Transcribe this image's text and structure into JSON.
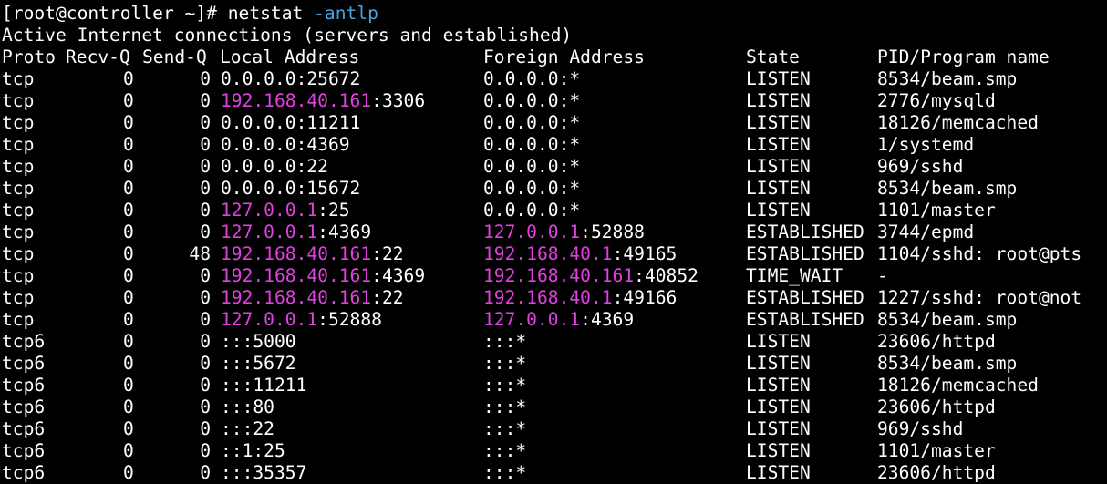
{
  "colors": {
    "background": "#000000",
    "text": "#ffffff",
    "ip_highlight": "#e040e0",
    "flag_highlight": "#4aa3e0"
  },
  "prompt": {
    "text": "[root@controller ~]# ",
    "command": "netstat",
    "flags": "-antlp"
  },
  "summary": "Active Internet connections (servers and established)",
  "headers": {
    "proto": "Proto",
    "recvq": "Recv-Q",
    "sendq": "Send-Q",
    "local": "Local Address",
    "foreign": "Foreign Address",
    "state": "State",
    "pid": "PID/Program name"
  },
  "rows": [
    {
      "proto": "tcp",
      "recvq": "0",
      "sendq": "0",
      "local_ip": "",
      "local_rest": "0.0.0.0:25672",
      "foreign_ip": "",
      "foreign_rest": "0.0.0.0:*",
      "state": "LISTEN",
      "pid": "8534/beam.smp"
    },
    {
      "proto": "tcp",
      "recvq": "0",
      "sendq": "0",
      "local_ip": "192.168.40.161",
      "local_rest": ":3306",
      "foreign_ip": "",
      "foreign_rest": "0.0.0.0:*",
      "state": "LISTEN",
      "pid": "2776/mysqld"
    },
    {
      "proto": "tcp",
      "recvq": "0",
      "sendq": "0",
      "local_ip": "",
      "local_rest": "0.0.0.0:11211",
      "foreign_ip": "",
      "foreign_rest": "0.0.0.0:*",
      "state": "LISTEN",
      "pid": "18126/memcached"
    },
    {
      "proto": "tcp",
      "recvq": "0",
      "sendq": "0",
      "local_ip": "",
      "local_rest": "0.0.0.0:4369",
      "foreign_ip": "",
      "foreign_rest": "0.0.0.0:*",
      "state": "LISTEN",
      "pid": "1/systemd"
    },
    {
      "proto": "tcp",
      "recvq": "0",
      "sendq": "0",
      "local_ip": "",
      "local_rest": "0.0.0.0:22",
      "foreign_ip": "",
      "foreign_rest": "0.0.0.0:*",
      "state": "LISTEN",
      "pid": "969/sshd"
    },
    {
      "proto": "tcp",
      "recvq": "0",
      "sendq": "0",
      "local_ip": "",
      "local_rest": "0.0.0.0:15672",
      "foreign_ip": "",
      "foreign_rest": "0.0.0.0:*",
      "state": "LISTEN",
      "pid": "8534/beam.smp"
    },
    {
      "proto": "tcp",
      "recvq": "0",
      "sendq": "0",
      "local_ip": "127.0.0.1",
      "local_rest": ":25",
      "foreign_ip": "",
      "foreign_rest": "0.0.0.0:*",
      "state": "LISTEN",
      "pid": "1101/master"
    },
    {
      "proto": "tcp",
      "recvq": "0",
      "sendq": "0",
      "local_ip": "127.0.0.1",
      "local_rest": ":4369",
      "foreign_ip": "127.0.0.1",
      "foreign_rest": ":52888",
      "state": "ESTABLISHED",
      "pid": "3744/epmd"
    },
    {
      "proto": "tcp",
      "recvq": "0",
      "sendq": "48",
      "local_ip": "192.168.40.161",
      "local_rest": ":22",
      "foreign_ip": "192.168.40.1",
      "foreign_rest": ":49165",
      "state": "ESTABLISHED",
      "pid": "1104/sshd: root@pts"
    },
    {
      "proto": "tcp",
      "recvq": "0",
      "sendq": "0",
      "local_ip": "192.168.40.161",
      "local_rest": ":4369",
      "foreign_ip": "192.168.40.161",
      "foreign_rest": ":40852",
      "state": "TIME_WAIT",
      "pid": "-"
    },
    {
      "proto": "tcp",
      "recvq": "0",
      "sendq": "0",
      "local_ip": "192.168.40.161",
      "local_rest": ":22",
      "foreign_ip": "192.168.40.1",
      "foreign_rest": ":49166",
      "state": "ESTABLISHED",
      "pid": "1227/sshd: root@not"
    },
    {
      "proto": "tcp",
      "recvq": "0",
      "sendq": "0",
      "local_ip": "127.0.0.1",
      "local_rest": ":52888",
      "foreign_ip": "127.0.0.1",
      "foreign_rest": ":4369",
      "state": "ESTABLISHED",
      "pid": "8534/beam.smp"
    },
    {
      "proto": "tcp6",
      "recvq": "0",
      "sendq": "0",
      "local_ip": "",
      "local_rest": ":::5000",
      "foreign_ip": "",
      "foreign_rest": ":::*",
      "state": "LISTEN",
      "pid": "23606/httpd"
    },
    {
      "proto": "tcp6",
      "recvq": "0",
      "sendq": "0",
      "local_ip": "",
      "local_rest": ":::5672",
      "foreign_ip": "",
      "foreign_rest": ":::*",
      "state": "LISTEN",
      "pid": "8534/beam.smp"
    },
    {
      "proto": "tcp6",
      "recvq": "0",
      "sendq": "0",
      "local_ip": "",
      "local_rest": ":::11211",
      "foreign_ip": "",
      "foreign_rest": ":::*",
      "state": "LISTEN",
      "pid": "18126/memcached"
    },
    {
      "proto": "tcp6",
      "recvq": "0",
      "sendq": "0",
      "local_ip": "",
      "local_rest": ":::80",
      "foreign_ip": "",
      "foreign_rest": ":::*",
      "state": "LISTEN",
      "pid": "23606/httpd"
    },
    {
      "proto": "tcp6",
      "recvq": "0",
      "sendq": "0",
      "local_ip": "",
      "local_rest": ":::22",
      "foreign_ip": "",
      "foreign_rest": ":::*",
      "state": "LISTEN",
      "pid": "969/sshd"
    },
    {
      "proto": "tcp6",
      "recvq": "0",
      "sendq": "0",
      "local_ip": "",
      "local_rest": "::1:25",
      "foreign_ip": "",
      "foreign_rest": ":::*",
      "state": "LISTEN",
      "pid": "1101/master"
    },
    {
      "proto": "tcp6",
      "recvq": "0",
      "sendq": "0",
      "local_ip": "",
      "local_rest": ":::35357",
      "foreign_ip": "",
      "foreign_rest": ":::*",
      "state": "LISTEN",
      "pid": "23606/httpd"
    }
  ]
}
